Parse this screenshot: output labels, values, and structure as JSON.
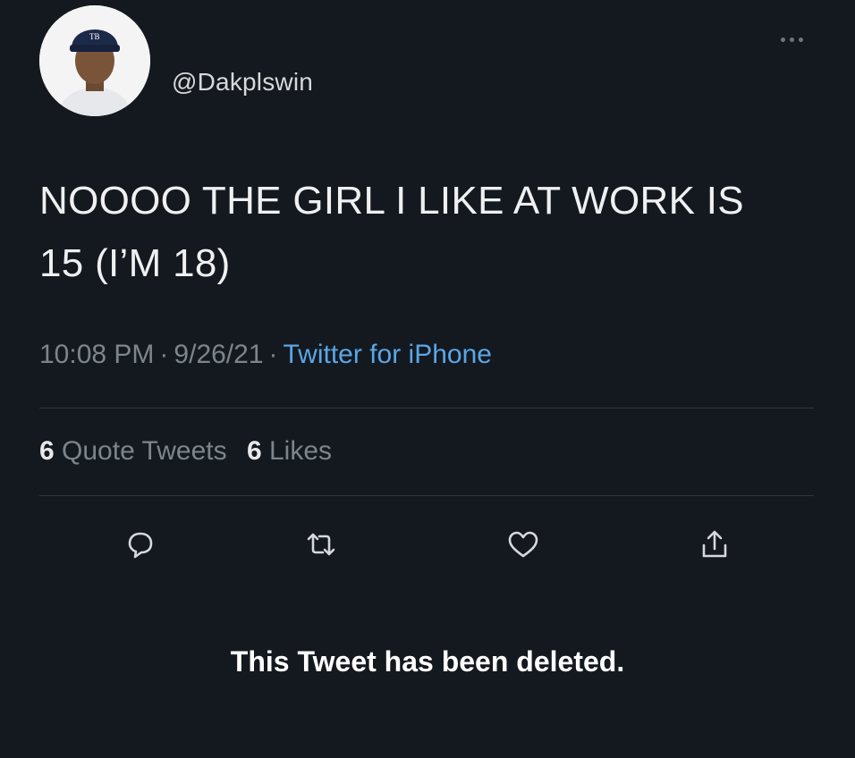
{
  "user": {
    "handle": "@Dakplswin",
    "avatar_icon": "person-avatar-icon"
  },
  "tweet": {
    "text_line1": "NOOOO THE GIRL I LIKE AT WORK IS",
    "text_line2": "15 (I’M 18)",
    "time": "10:08 PM",
    "date": "9/26/21",
    "separator": "·",
    "source": "Twitter for iPhone"
  },
  "stats": {
    "quote_count": "6",
    "quote_label": "Quote Tweets",
    "like_count": "6",
    "like_label": "Likes"
  },
  "actions": [
    "reply-icon",
    "retweet-icon",
    "like-icon",
    "share-icon"
  ],
  "notice": "This Tweet has been deleted.",
  "colors": {
    "background": "#14191f",
    "link": "#5aa6e6",
    "muted": "#7c858d"
  }
}
